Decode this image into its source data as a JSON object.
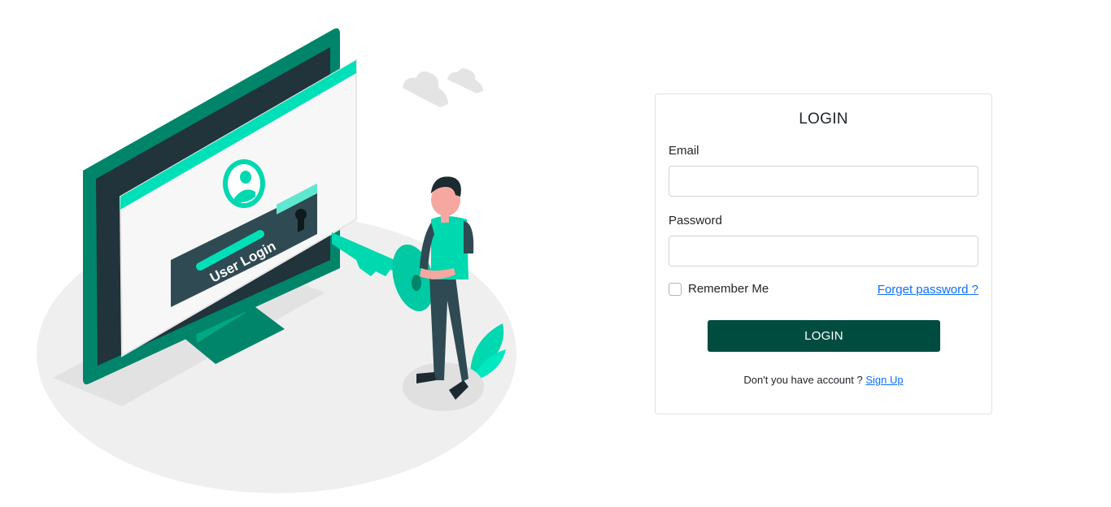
{
  "illustration": {
    "screen_text": "User Login",
    "accent_color": "#00d8b0",
    "dark_teal": "#00856a",
    "icons": [
      "monitor-illustration",
      "user-avatar-icon",
      "keyhole-icon",
      "key-icon",
      "person-figure",
      "plant-leaf",
      "cloud-icon"
    ]
  },
  "login": {
    "title": "LOGIN",
    "email_label": "Email",
    "email_value": "",
    "email_placeholder": "",
    "password_label": "Password",
    "password_value": "",
    "password_placeholder": "",
    "remember_label": "Remember Me",
    "remember_checked": false,
    "forgot_label": "Forget password ?",
    "button_label": "LOGIN",
    "signup_prompt": "Don't you have account ?",
    "signup_label": "Sign Up",
    "button_color": "#004d40",
    "link_color": "#0d6efd"
  }
}
